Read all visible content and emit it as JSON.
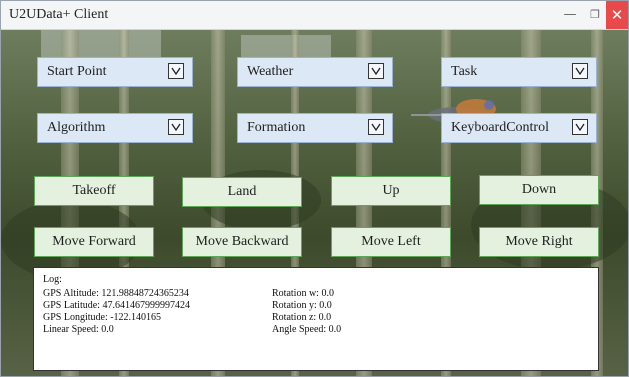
{
  "window": {
    "title": "U2UData+ Client"
  },
  "dropdowns": [
    {
      "label": "Start Point"
    },
    {
      "label": "Weather"
    },
    {
      "label": "Task"
    },
    {
      "label": "Algorithm"
    },
    {
      "label": "Formation"
    },
    {
      "label": "KeyboardControl"
    }
  ],
  "buttons": [
    {
      "label": "Takeoff"
    },
    {
      "label": "Land"
    },
    {
      "label": "Up"
    },
    {
      "label": "Down"
    },
    {
      "label": "Move Forward"
    },
    {
      "label": "Move Backward"
    },
    {
      "label": "Move Left"
    },
    {
      "label": "Move Right"
    }
  ],
  "log": {
    "title": "Log:",
    "left": [
      "GPS Altitude: 121.98848724365234",
      "GPS Latitude: 47.641467999997424",
      "GPS Longitude: -122.140165",
      "Linear Speed: 0.0"
    ],
    "right": [
      "Rotation w: 0.0",
      "Rotation y:  0.0",
      "Rotation z:  0.0",
      "Angle Speed: 0.0"
    ]
  },
  "colors": {
    "dropdown_bg": "#dde8f6",
    "button_bg": "#e4f1df",
    "button_border": "#5fa658",
    "close_btn": "#e8494a"
  },
  "icons": {
    "minimize": "minimize-icon",
    "maximize": "restore-icon",
    "close": "close-icon",
    "dropdown": "chevron-down-icon"
  }
}
